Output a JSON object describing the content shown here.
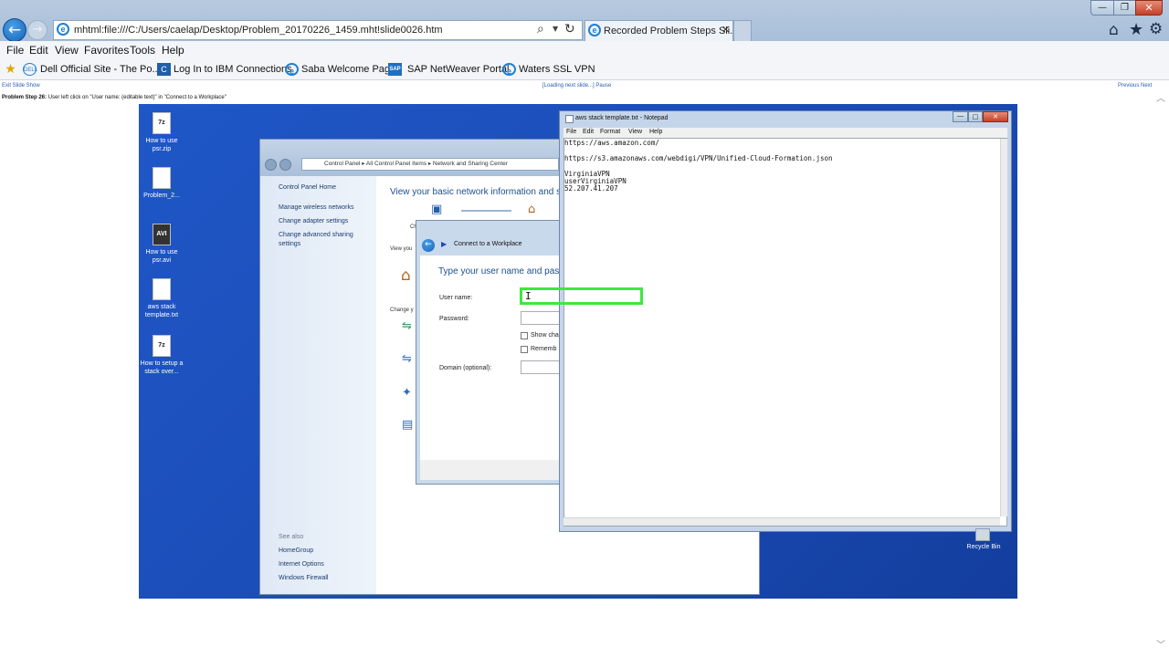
{
  "browser": {
    "address": "mhtml:file:///C:/Users/caelap/Desktop/Problem_20170226_1459.mht!slide0026.htm",
    "tab_title": "Recorded Problem Steps Sli...",
    "menu": [
      "File",
      "Edit",
      "View",
      "Favorites",
      "Tools",
      "Help"
    ],
    "favorites": [
      "Dell Official Site - The Po...",
      "Log In to IBM Connections",
      "Saba Welcome Page",
      "SAP NetWeaver Portal",
      "Waters SSL VPN"
    ]
  },
  "slide": {
    "exit_link": "Exit Slide Show",
    "status": "[Loading next slide...] Pause",
    "nav": "Previous Next",
    "step_label": "Problem Step 26:",
    "step_text": "User left click on \"User name: (editable text)\" in \"Connect to a Workplace\""
  },
  "desktop": {
    "icons": [
      "How to use psr.zip",
      "Problem_2...",
      "How to use psr.avi",
      "aws stack template.txt",
      "How to setup a stack over..."
    ],
    "icon_badges": [
      "7z",
      "AVI",
      "7z"
    ],
    "recycle_bin": "Recycle Bin"
  },
  "control_panel": {
    "breadcrumb": [
      "Control Panel",
      "All Control Panel Items",
      "Network and Sharing Center"
    ],
    "sidebar_links": [
      "Control Panel Home",
      "Manage wireless networks",
      "Change adapter settings",
      "Change advanced sharing settings"
    ],
    "see_also_label": "See also",
    "see_also": [
      "HomeGroup",
      "Internet Options",
      "Windows Firewall"
    ],
    "heading": "View your basic network information and s",
    "fragments": [
      "Ch",
      "View you",
      "Change y"
    ]
  },
  "connect_dialog": {
    "title": "Connect to a Workplace",
    "heading": "Type your user name and passw",
    "user_label": "User name:",
    "password_label": "Password:",
    "show_chars": "Show cha",
    "remember": "Rememb",
    "domain_label": "Domain (optional):"
  },
  "notepad": {
    "title": "aws stack template.txt - Notepad",
    "menu": [
      "File",
      "Edit",
      "Format",
      "View",
      "Help"
    ],
    "lines": [
      "https://aws.amazon.com/",
      "",
      "https://s3.amazonaws.com/webdigi/VPN/Unified-Cloud-Formation.json",
      "",
      "VirginiaVPN",
      "userVirginiaVPN",
      "52.207.41.207"
    ]
  }
}
